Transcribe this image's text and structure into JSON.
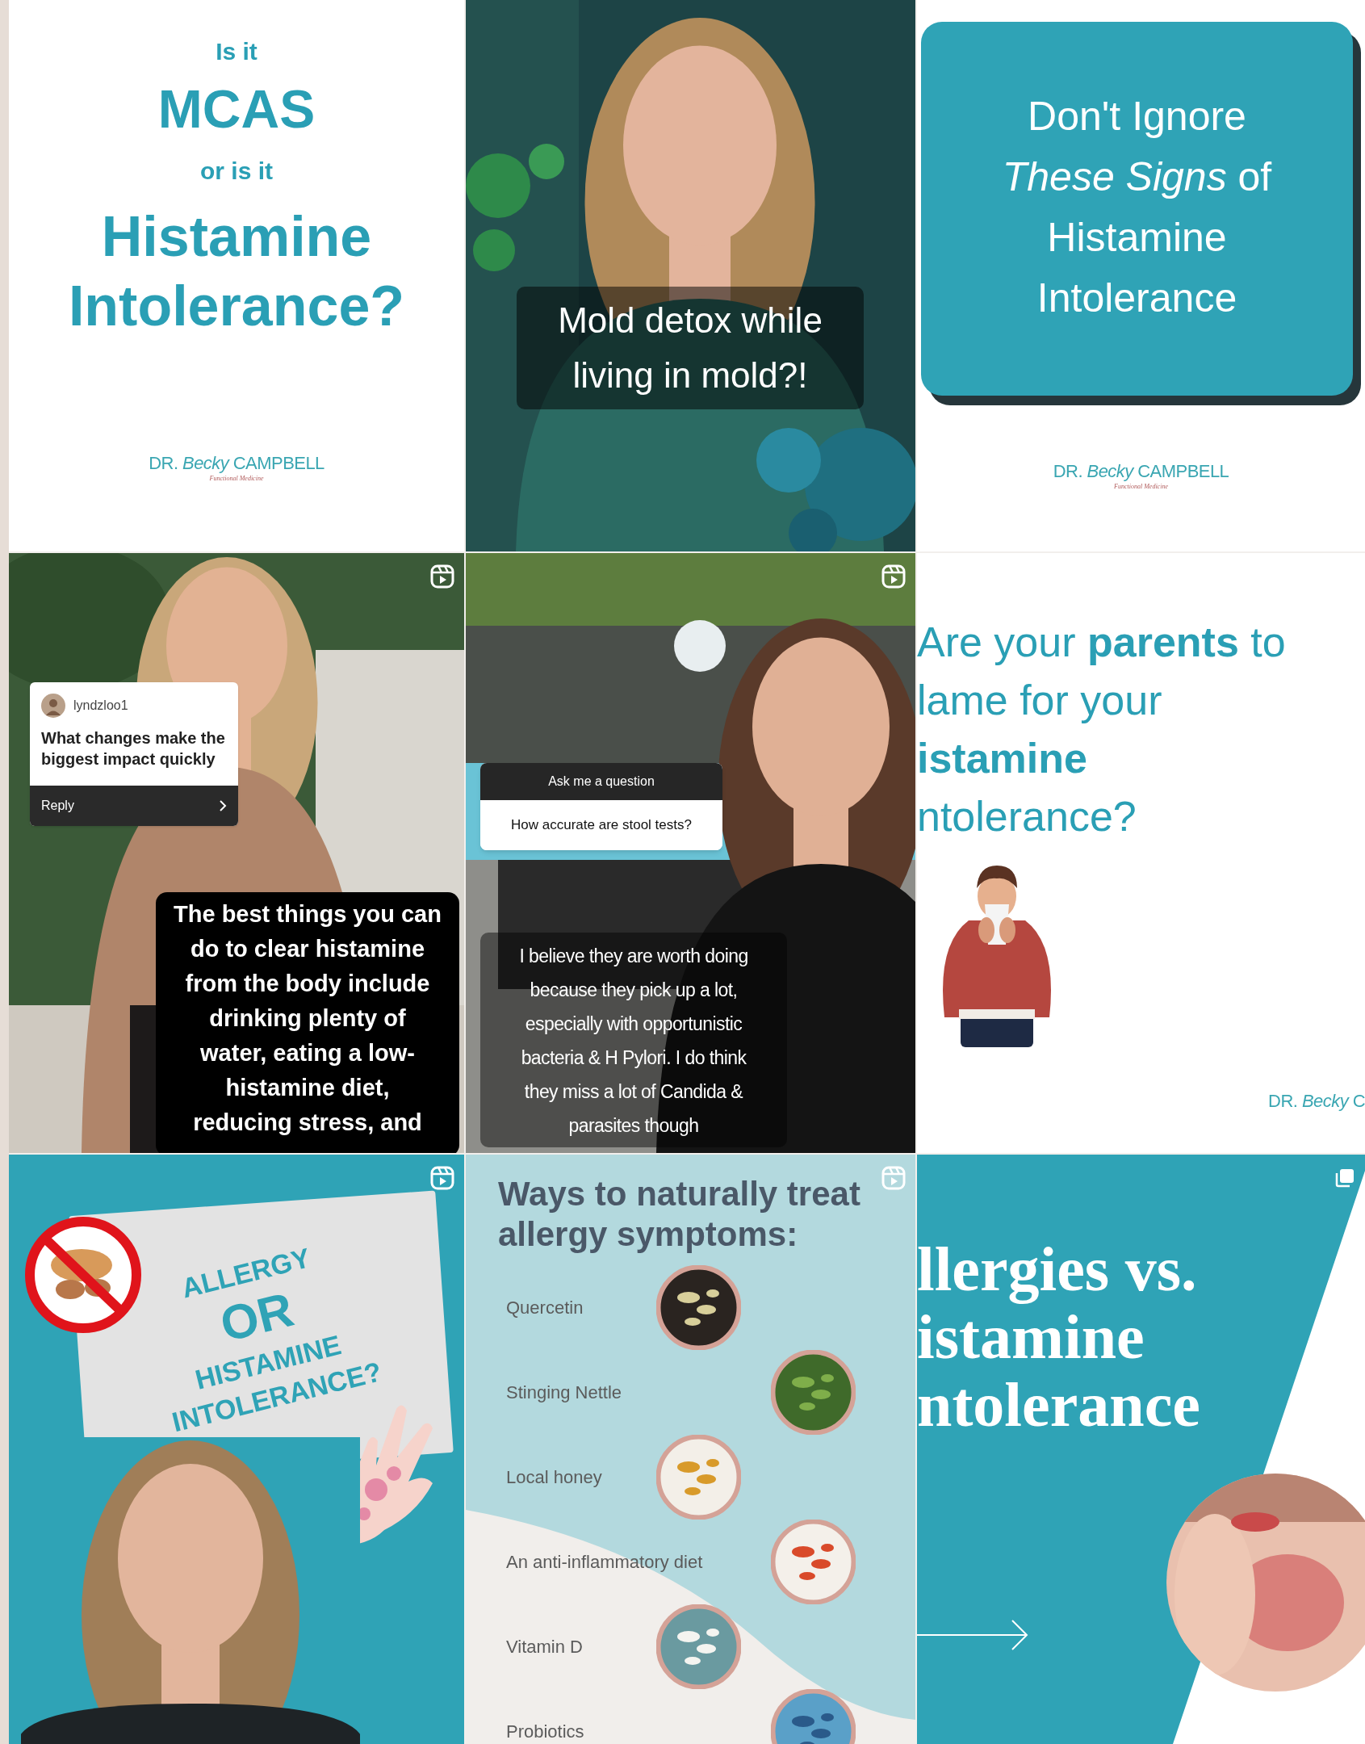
{
  "posts": [
    {
      "kind": "title-card",
      "intro": "Is it",
      "term_1": "MCAS",
      "connector": "or is it",
      "term_2": [
        "Histamine",
        "Intolerance?"
      ],
      "logo": {
        "name": "DR. *Becky* CAMPBELL",
        "tagline": "Functional Medicine"
      }
    },
    {
      "kind": "photo-caption",
      "caption": [
        "Mold detox while",
        "living in mold?!"
      ]
    },
    {
      "kind": "banner-card",
      "heading": [
        "Don't Ignore",
        "*These Signs* of",
        "Histamine",
        "Intolerance"
      ],
      "logo": {
        "name": "DR. *Becky* CAMPBELL",
        "tagline": "Functional Medicine"
      }
    },
    {
      "kind": "question-reply",
      "badge": {
        "kind": "reel"
      },
      "question": {
        "user": "lyndzloo1",
        "text": "What changes make the biggest impact quickly",
        "action": "Reply"
      },
      "caption": [
        "The best things you can",
        "do to clear histamine",
        "from the body include",
        "drinking plenty of",
        "water, eating a low-",
        "histamine diet,",
        "reducing stress, and"
      ]
    },
    {
      "kind": "question-answer",
      "badge": {
        "kind": "reel"
      },
      "question": {
        "prompt": "Ask me a question",
        "text": "How accurate are stool tests?"
      },
      "caption": [
        "I believe they are worth doing",
        "because they pick up a lot,",
        "especially with opportunistic",
        "bacteria & H Pylori. I do think",
        "they miss a lot of Candida &",
        "parasites though"
      ]
    },
    {
      "kind": "illustration-card",
      "heading": [
        "Are your **parents** to",
        "lame for your",
        "**istamine**",
        "ntolerance?"
      ],
      "logo": {
        "name": "DR. *Becky* C"
      }
    },
    {
      "kind": "video-bubble",
      "badge": {
        "kind": "reel"
      },
      "bubble": [
        "ALLERGY",
        "OR",
        "HISTAMINE",
        "INTOLERANCE?"
      ]
    },
    {
      "kind": "list-card",
      "badge": {
        "kind": "reel"
      },
      "title": [
        "Ways to naturally treat",
        "allergy symptoms:"
      ],
      "items": [
        "Quercetin",
        "Stinging Nettle",
        "Local honey",
        "An anti-inflammatory diet",
        "Vitamin D",
        "Probiotics"
      ]
    },
    {
      "kind": "split-title",
      "badge": {
        "kind": "carousel"
      },
      "heading": [
        "llergies vs.",
        "istamine",
        "ntolerance"
      ]
    }
  ]
}
